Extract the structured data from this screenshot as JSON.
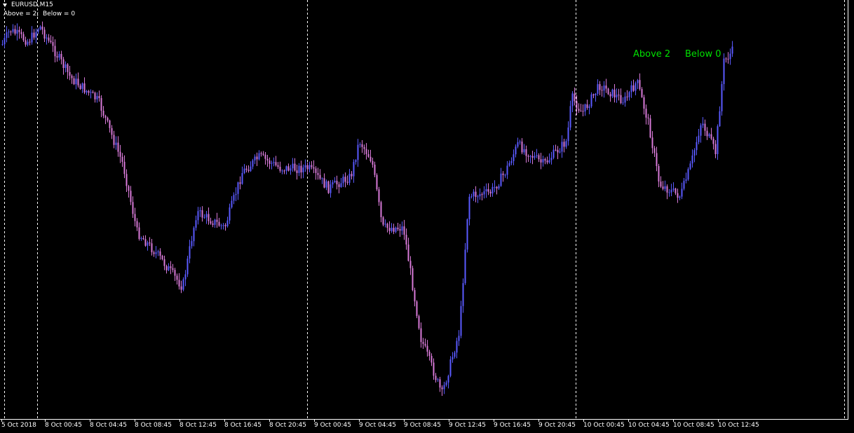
{
  "header": {
    "symbol_timeframe": "EURUSD,M15"
  },
  "indicator_line": "Above = 2;  Below = 0",
  "overlay": {
    "above": "Above 2",
    "below": "Below 0",
    "color": "#00e000"
  },
  "colors": {
    "background": "#000000",
    "bull_candle": "#5a5aff",
    "bear_candle": "#d87ad8",
    "separator": "#ffffff",
    "axis_text": "#ffffff"
  },
  "time_axis": {
    "labels": [
      "5 Oct 2018",
      "8 Oct 00:45",
      "8 Oct 04:45",
      "8 Oct 08:45",
      "8 Oct 12:45",
      "8 Oct 16:45",
      "8 Oct 20:45",
      "9 Oct 00:45",
      "9 Oct 04:45",
      "9 Oct 08:45",
      "9 Oct 12:45",
      "9 Oct 16:45",
      "9 Oct 20:45",
      "10 Oct 00:45",
      "10 Oct 04:45",
      "10 Oct 08:45",
      "10 Oct 12:45"
    ]
  },
  "chart_data": {
    "type": "line",
    "x": [
      "5 Oct 2018",
      "8 Oct 00:45",
      "8 Oct 04:45",
      "8 Oct 08:45",
      "8 Oct 12:45",
      "8 Oct 16:45",
      "8 Oct 20:45",
      "9 Oct 00:45",
      "9 Oct 04:45",
      "9 Oct 08:45",
      "9 Oct 12:45",
      "9 Oct 16:45",
      "9 Oct 20:45",
      "10 Oct 00:45",
      "10 Oct 04:45",
      "10 Oct 08:45",
      "10 Oct 12:45"
    ],
    "series": [
      {
        "values": [
          0.94,
          0.78,
          0.62,
          0.36,
          0.35,
          0.52,
          0.58,
          0.56,
          0.63,
          0.3,
          0.2,
          0.62,
          0.65,
          0.76,
          0.74,
          0.57,
          0.92
        ]
      }
    ],
    "ylim": [
      0,
      1
    ],
    "grid": false
  }
}
